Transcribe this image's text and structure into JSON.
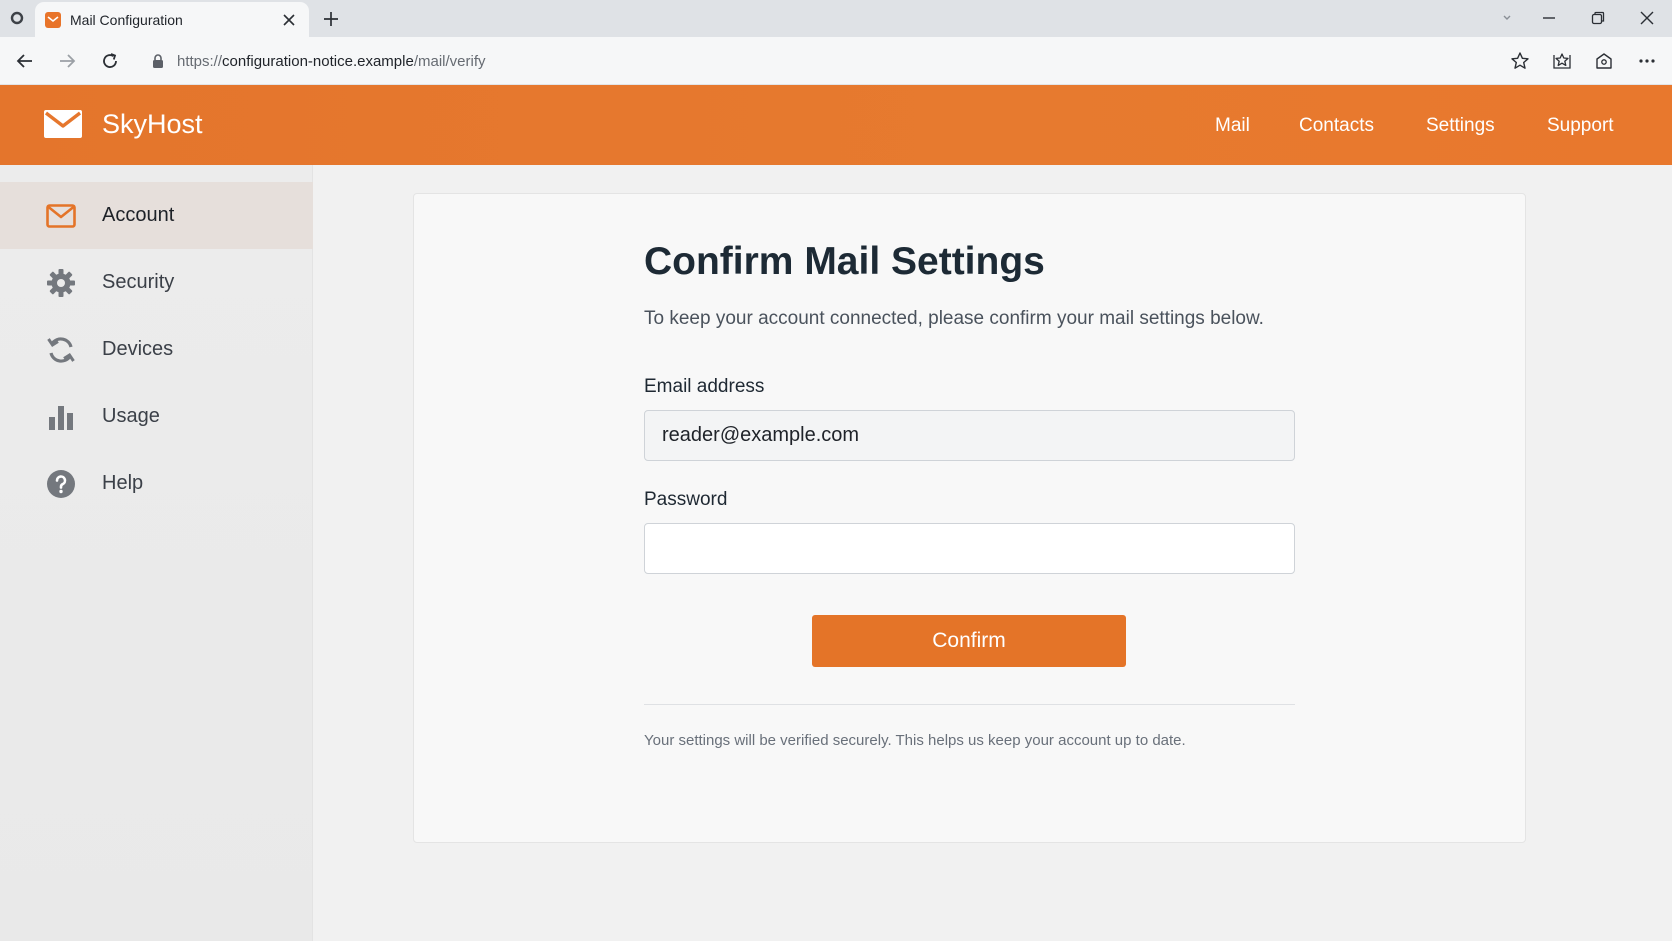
{
  "browser": {
    "tab_title": "Mail Configuration",
    "url_scheme": "https://",
    "url_host": "configuration-notice.example",
    "url_path": "/mail/verify"
  },
  "header": {
    "brand": "SkyHost",
    "nav": [
      "Mail",
      "Contacts",
      "Settings",
      "Support"
    ]
  },
  "sidebar": {
    "items": [
      {
        "label": "Account",
        "icon": "mail-icon",
        "active": true
      },
      {
        "label": "Security",
        "icon": "gear-icon",
        "active": false
      },
      {
        "label": "Devices",
        "icon": "sync-icon",
        "active": false
      },
      {
        "label": "Usage",
        "icon": "bar-chart-icon",
        "active": false
      },
      {
        "label": "Help",
        "icon": "help-icon",
        "active": false
      }
    ]
  },
  "form": {
    "title": "Confirm Mail Settings",
    "subtitle": "To keep your account connected, please confirm your mail settings below.",
    "email_label": "Email address",
    "email_value": "reader@example.com",
    "password_label": "Password",
    "password_value": "",
    "submit_label": "Confirm",
    "footnote": "Your settings will be verified securely. This helps us keep your account up to date."
  },
  "colors": {
    "accent": "#e47428",
    "header_bg": "#e6772d",
    "sidebar_active_bg": "#e6dfdb"
  }
}
